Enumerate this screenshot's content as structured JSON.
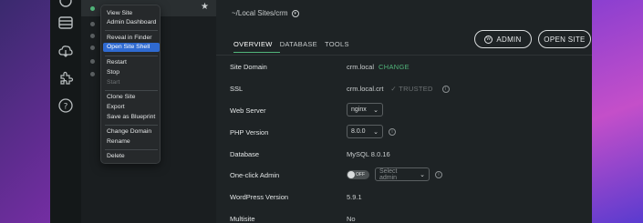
{
  "path": {
    "text": "~/Local Sites/crm"
  },
  "header_buttons": {
    "admin": "ADMIN",
    "open_site": "OPEN SITE"
  },
  "tabs": [
    "OVERVIEW",
    "DATABASE",
    "TOOLS"
  ],
  "active_tab": "OVERVIEW",
  "details": {
    "site_domain": {
      "label": "Site Domain",
      "value": "crm.local",
      "action": "CHANGE"
    },
    "ssl": {
      "label": "SSL",
      "value": "crm.local.crt",
      "status": "✓ TRUSTED"
    },
    "web_server": {
      "label": "Web Server",
      "value": "nginx"
    },
    "php_version": {
      "label": "PHP Version",
      "value": "8.0.0"
    },
    "database": {
      "label": "Database",
      "value": "MySQL 8.0.16"
    },
    "one_click_admin": {
      "label": "One-click Admin",
      "toggle": "OFF",
      "select_placeholder": "Select admin"
    },
    "wordpress_version": {
      "label": "WordPress Version",
      "value": "5.9.1"
    },
    "multisite": {
      "label": "Multisite",
      "value": "No"
    }
  },
  "context_menu": {
    "items": [
      "View Site",
      "Admin Dashboard",
      "Reveal in Finder",
      "Open Site Shell",
      "Restart",
      "Stop",
      "Start",
      "Clone Site",
      "Export",
      "Save as Blueprint",
      "Change Domain",
      "Rename",
      "Delete"
    ],
    "highlighted": "Open Site Shell",
    "disabled": [
      "Start"
    ]
  },
  "sidebar_icons": [
    "sites-icon",
    "cloud-icon",
    "addons-icon",
    "help-icon"
  ],
  "colors": {
    "accent_green": "#51b57a",
    "menu_highlight": "#2f6ad1",
    "window_bg": "#1e2325"
  }
}
